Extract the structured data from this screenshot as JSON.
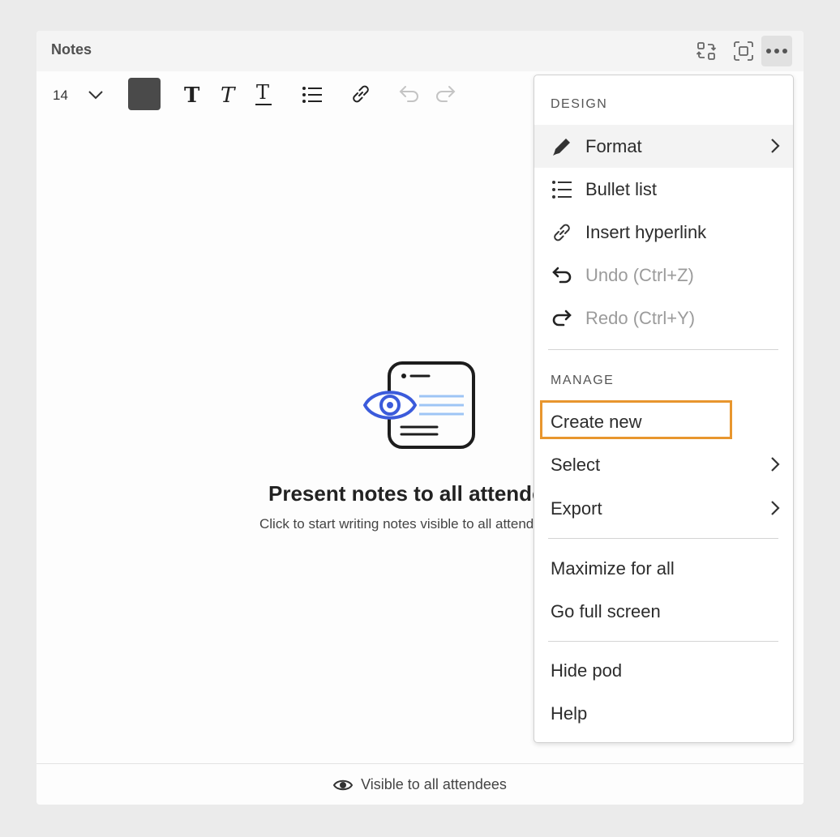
{
  "pod": {
    "title": "Notes",
    "font_size": "14",
    "empty_state": {
      "title": "Present notes to all attendees",
      "subtitle": "Click to start writing notes visible to all attendees"
    },
    "footer": "Visible to all attendees"
  },
  "menu": {
    "design_header": "DESIGN",
    "format": "Format",
    "bullet_list": "Bullet list",
    "insert_hyperlink": "Insert hyperlink",
    "undo": "Undo (Ctrl+Z)",
    "redo": "Redo (Ctrl+Y)",
    "manage_header": "MANAGE",
    "create_new": "Create new",
    "select": "Select",
    "export": "Export",
    "maximize_for_all": "Maximize for all",
    "go_full_screen": "Go full screen",
    "hide_pod": "Hide pod",
    "help": "Help"
  },
  "colors": {
    "highlight": "#e8962e",
    "accent": "#3b5bdb",
    "text_color_swatch": "#4a4a4a"
  }
}
